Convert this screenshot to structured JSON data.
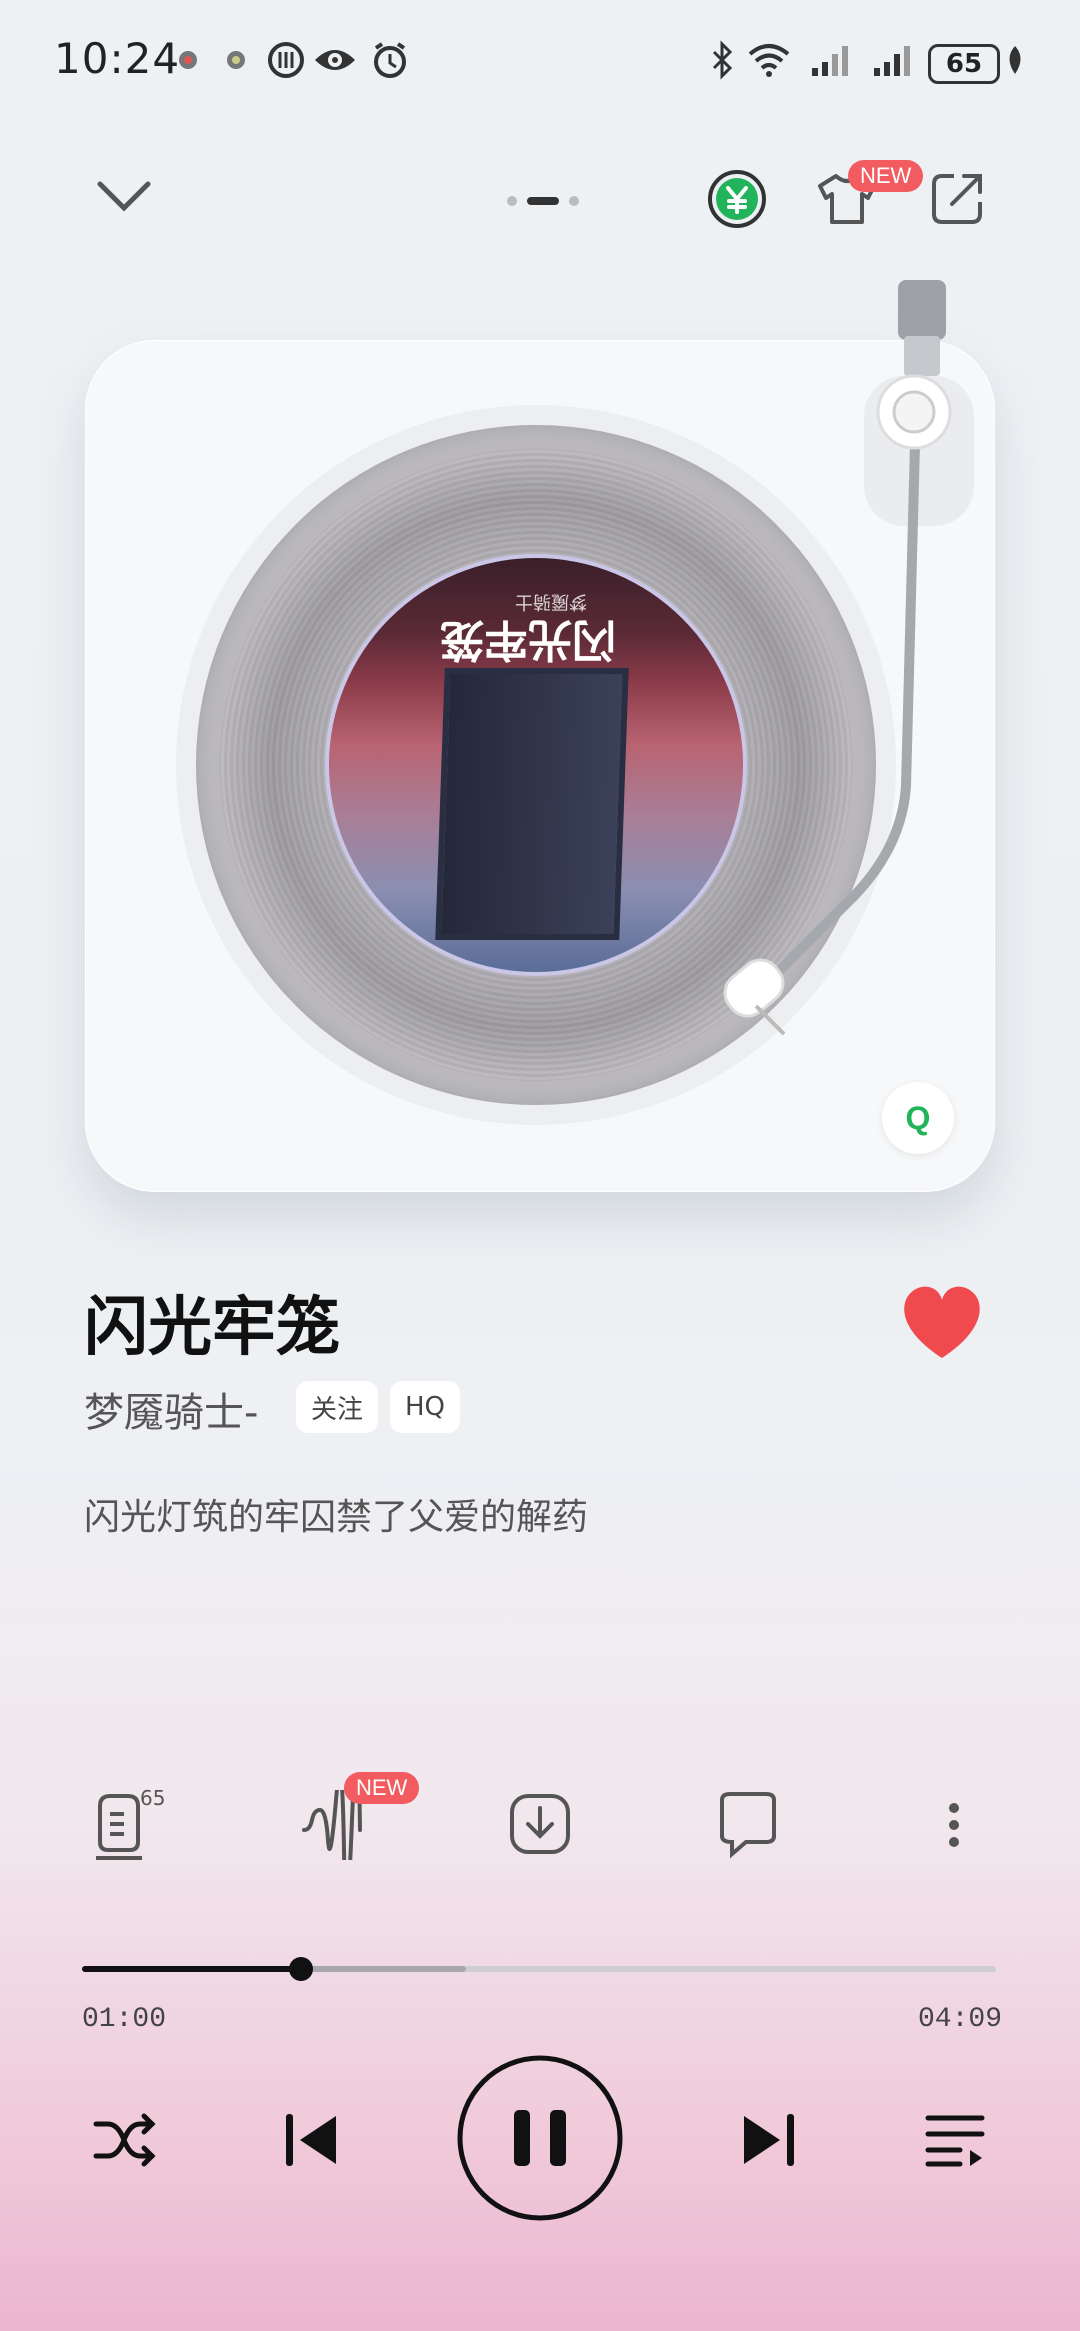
{
  "status_bar": {
    "time": "10:24",
    "battery": "65"
  },
  "header": {
    "new_badge": "NEW"
  },
  "album_label": {
    "title": "闪光牢笼",
    "artist": "梦魇骑士"
  },
  "song": {
    "title": "闪光牢笼",
    "artist": "梦魇骑士-",
    "follow_label": "关注",
    "quality_label": "HQ",
    "lyric": "闪光灯筑的牢囚禁了父爱的解药",
    "liked": true
  },
  "actions": {
    "comment_count": "65",
    "effect_badge": "NEW"
  },
  "progress": {
    "current": "01:00",
    "total": "04:09",
    "played_fraction": 0.24,
    "buffered_fraction": 0.42
  },
  "colors": {
    "like": "#f04a4f",
    "accent_green": "#22b45a",
    "badge": "#f25b5f"
  },
  "icons": {
    "collapse": "chevron-down-icon",
    "vip": "yen-icon",
    "skin": "tshirt-icon",
    "share": "share-icon",
    "lyrics": "lyrics-icon",
    "effect": "waveform-icon",
    "download": "download-icon",
    "comment": "comment-icon",
    "more": "more-icon",
    "shuffle": "shuffle-icon",
    "prev": "previous-icon",
    "pause": "pause-icon",
    "next": "next-icon",
    "playlist": "playlist-icon"
  }
}
